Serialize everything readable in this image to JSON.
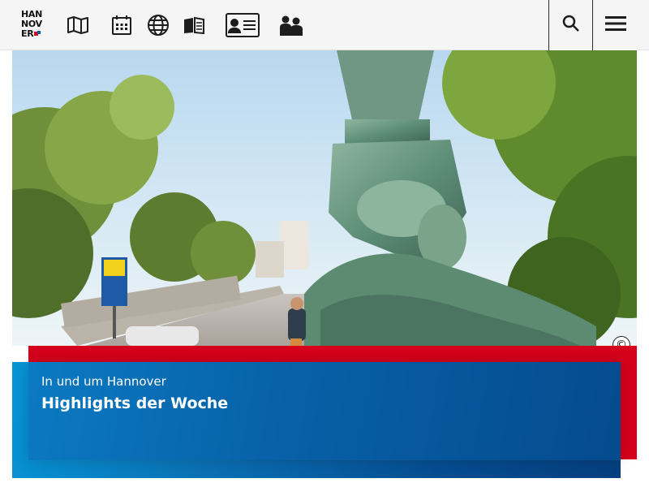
{
  "header": {
    "logo_lines": [
      "HAN",
      "NOV",
      "ER"
    ],
    "nav_icons": [
      "map-icon",
      "calendar-icon",
      "globe-icon",
      "book-icon",
      "id-card-icon",
      "people-icon"
    ],
    "tools": [
      "search-icon",
      "menu-icon"
    ]
  },
  "hero": {
    "copyright_symbol": "©",
    "image_subject": "statue-fountain-street-scene"
  },
  "teaser": {
    "kicker": "In und um Hannover",
    "headline": "Highlights der Woche"
  },
  "colors": {
    "accent_red": "#d6001c",
    "blue_light": "#0795d6",
    "blue_dark": "#063f80",
    "header_bg": "#f5f5f5"
  }
}
